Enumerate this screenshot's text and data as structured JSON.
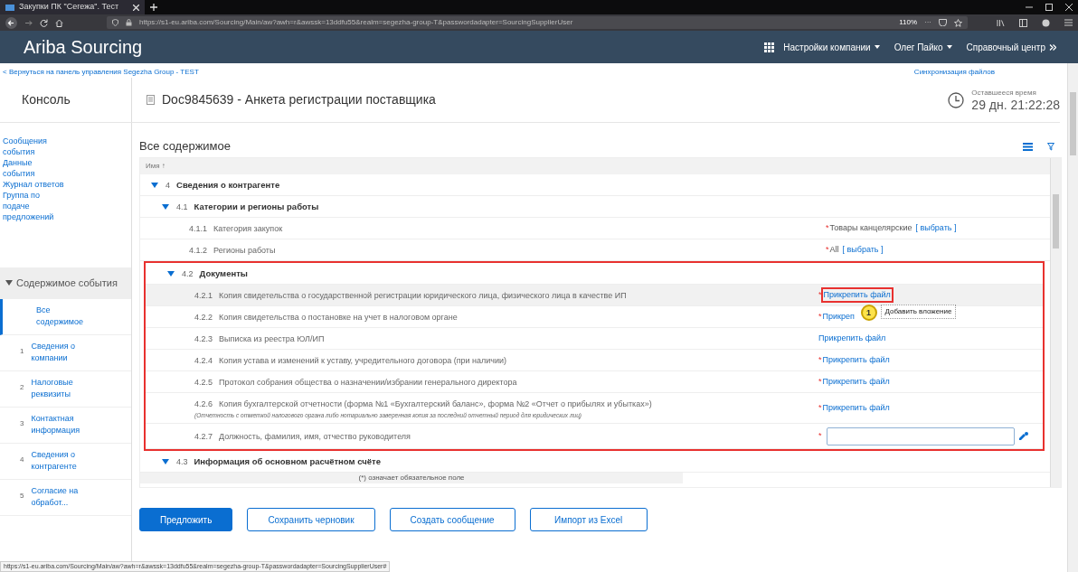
{
  "browser": {
    "tab_title": "Закупки ПК \"Сегежа\". Тест",
    "url": "https://s1-eu.ariba.com/Sourcing/Main/aw?awh=r&awssk=13ddfu55&realm=segezha-group-T&passwordadapter=SourcingSupplierUser",
    "zoom": "110%",
    "more": "···"
  },
  "app": {
    "title": "Ariba Sourcing",
    "menus": [
      "Настройки компании",
      "Олег Пайко"
    ],
    "help": "Справочный центр"
  },
  "back_link": "< Вернуться на панель управления Segezha Group - TEST",
  "sync_link": "Синхронизация файлов",
  "console": "Консоль",
  "document_title": "Doc9845639 - Анкета регистрации поставщика",
  "timer": {
    "label": "Оставшееся время",
    "value": "29 дн. 21:22:28"
  },
  "sidebar": {
    "links": [
      "Сообщения события",
      "Данные события",
      "Журнал ответов",
      "Группа по подаче предложений"
    ],
    "section": {
      "label": "Содержимое события",
      "expanded": true
    },
    "items": [
      {
        "label": "Все содержимое",
        "selected": true
      },
      {
        "number": "1",
        "label": "Сведения о компании",
        "selected": false
      },
      {
        "number": "2",
        "label": "Налоговые реквизиты",
        "selected": false
      },
      {
        "number": "3",
        "label": "Контактная информация",
        "selected": false
      },
      {
        "number": "4",
        "label": "Сведения о контрагенте",
        "selected": false
      },
      {
        "number": "5",
        "label": "Согласие на обработ...",
        "selected": false
      }
    ]
  },
  "content": {
    "title": "Все содержимое",
    "column": "Имя ↑",
    "rows": [
      {
        "kind": "group",
        "number": "4",
        "label": "Сведения о контрагенте",
        "expanded": true,
        "highlighted": false,
        "children": [
          {
            "kind": "group",
            "number": "4.1",
            "label": "Категории и регионы работы",
            "expanded": true,
            "highlighted": false,
            "children": [
              {
                "kind": "item",
                "number": "4.1.1",
                "label": "Категория закупок",
                "hovered": false,
                "value": {
                  "kind": "select",
                  "required_marker": "*",
                  "text": "Товары канцелярские",
                  "link": "[ выбрать ]"
                }
              },
              {
                "kind": "item",
                "number": "4.1.2",
                "label": "Регионы работы",
                "hovered": false,
                "value": {
                  "kind": "select",
                  "required_marker": "*",
                  "text": "All",
                  "link": "[ выбрать ]"
                }
              }
            ]
          },
          {
            "kind": "group",
            "number": "4.2",
            "label": "Документы",
            "expanded": true,
            "highlighted": true,
            "children": [
              {
                "kind": "item",
                "number": "4.2.1",
                "label": "Копия свидетельства о государственной регистрации юридического лица, физического лица в качестве ИП",
                "hovered": true,
                "value": {
                  "kind": "file",
                  "required_marker": "*",
                  "link": "Прикрепить файл",
                  "highlighted": true,
                  "callout": "1",
                  "tooltip": "Добавить вложение"
                }
              },
              {
                "kind": "item",
                "number": "4.2.2",
                "label": "Копия свидетельства о постановке на учет в налоговом органе",
                "hovered": false,
                "value": {
                  "kind": "file",
                  "required_marker": "*",
                  "link": "Прикреп",
                  "highlighted": false
                }
              },
              {
                "kind": "item",
                "number": "4.2.3",
                "label": "Выписка из реестра ЮЛ/ИП",
                "hovered": false,
                "value": {
                  "kind": "file",
                  "link": "Прикрепить файл",
                  "highlighted": false
                }
              },
              {
                "kind": "item",
                "number": "4.2.4",
                "label": "Копия устава и изменений к уставу, учредительного договора (при наличии)",
                "hovered": false,
                "value": {
                  "kind": "file",
                  "required_marker": "*",
                  "link": "Прикрепить файл",
                  "highlighted": false
                }
              },
              {
                "kind": "item",
                "number": "4.2.5",
                "label": "Протокол собрания общества о назначении/избрании генерального директора",
                "hovered": false,
                "value": {
                  "kind": "file",
                  "required_marker": "*",
                  "link": "Прикрепить файл",
                  "highlighted": false
                }
              },
              {
                "kind": "item",
                "number": "4.2.6",
                "label": "Копия бухгалтерской отчетности (форма №1 «Бухгалтерский баланс», форма №2 «Отчет о прибылях и убытках»)",
                "note": "(Отчетность с отметкой налогового органа либо нотариально заверенная копия за последний отчетный период для юридических лиц)",
                "hovered": false,
                "value": {
                  "kind": "file",
                  "required_marker": "*",
                  "link": "Прикрепить файл",
                  "highlighted": false
                }
              },
              {
                "kind": "item",
                "number": "4.2.7",
                "label": "Должность, фамилия, имя, отчество руководителя",
                "hovered": false,
                "value": {
                  "kind": "input",
                  "required_marker": "*"
                }
              }
            ]
          },
          {
            "kind": "group",
            "number": "4.3",
            "label": "Информация об основном расчётном счёте",
            "expanded": true,
            "highlighted": false
          }
        ]
      }
    ],
    "footnote": "(*) означает обязательное поле"
  },
  "buttons": [
    {
      "label": "Предложить",
      "primary": true
    },
    {
      "label": "Сохранить черновик",
      "primary": false
    },
    {
      "label": "Создать сообщение",
      "primary": false
    },
    {
      "label": "Импорт из Excel",
      "primary": false
    }
  ],
  "status_bar": "https://s1-eu.ariba.com/Sourcing/Main/aw?awh=r&awssk=13ddfu55&realm=segezha-group-T&passwordadapter=SourcingSupplierUser#"
}
